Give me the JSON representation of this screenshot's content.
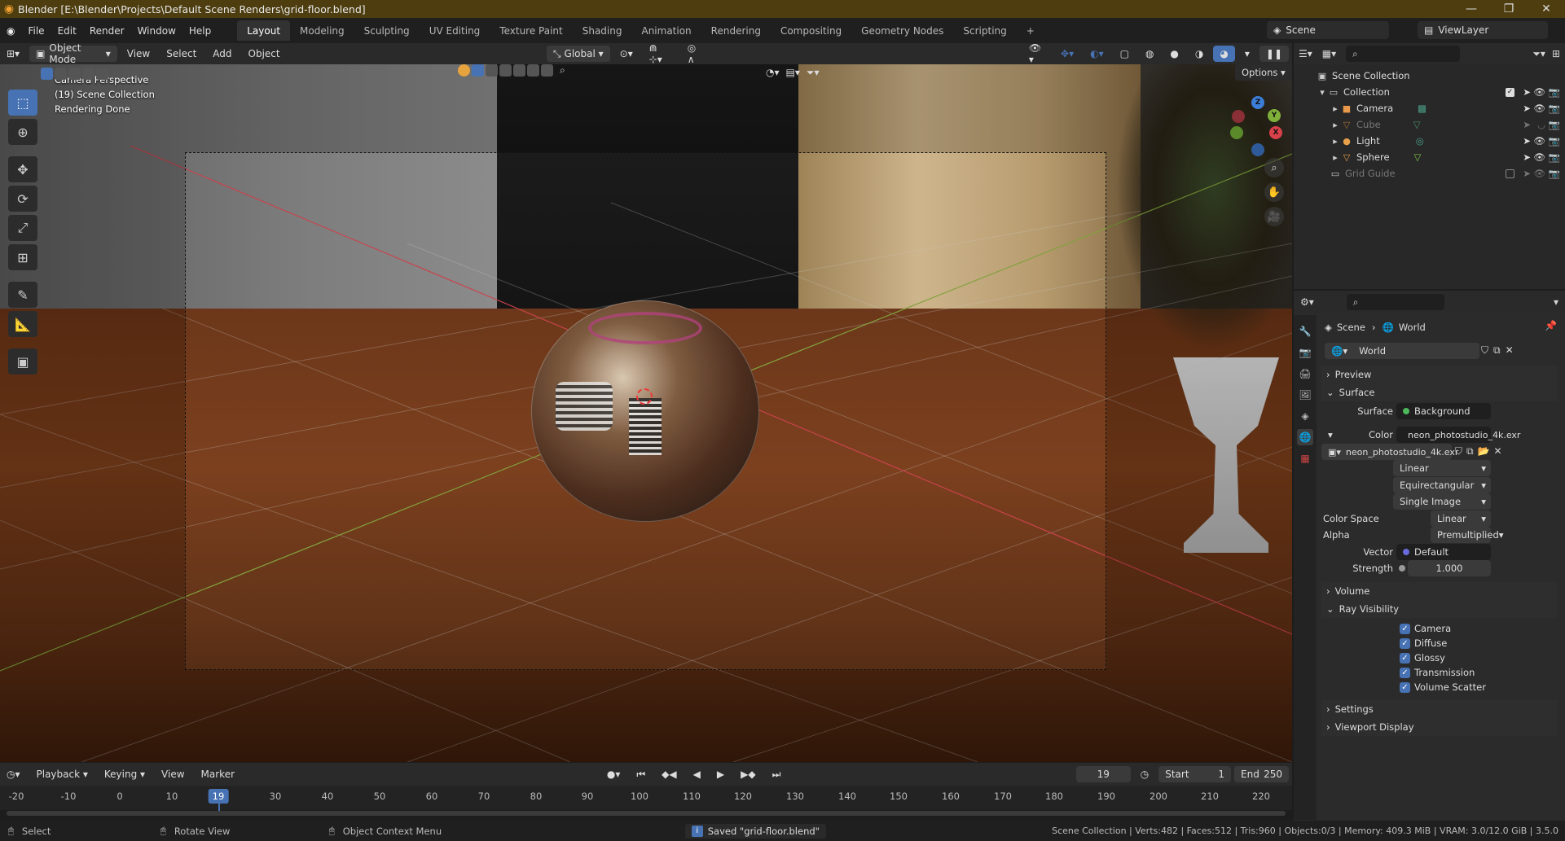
{
  "window": {
    "title": "Blender [E:\\Blender\\Projects\\Default Scene Renders\\grid-floor.blend]"
  },
  "menu": [
    "File",
    "Edit",
    "Render",
    "Window",
    "Help"
  ],
  "workspaces": [
    "Layout",
    "Modeling",
    "Sculpting",
    "UV Editing",
    "Texture Paint",
    "Shading",
    "Animation",
    "Rendering",
    "Compositing",
    "Geometry Nodes",
    "Scripting"
  ],
  "active_workspace": "Layout",
  "scene": {
    "name": "Scene",
    "viewlayer": "ViewLayer"
  },
  "viewport_header": {
    "mode": "Object Mode",
    "menus": [
      "View",
      "Select",
      "Add",
      "Object"
    ],
    "orientation": "Global"
  },
  "viewport": {
    "info": [
      "Camera Perspective",
      "(19) Scene Collection",
      "Rendering Done"
    ],
    "options_label": "Options"
  },
  "gizmo": {
    "z": "Z",
    "y": "Y",
    "x": "X"
  },
  "timeline": {
    "menus": [
      "Playback",
      "Keying",
      "View",
      "Marker"
    ],
    "current_frame": "19",
    "start_label": "Start",
    "start": "1",
    "end_label": "End",
    "end": "250",
    "ticks": [
      "-20",
      "-10",
      "0",
      "10",
      "19",
      "30",
      "40",
      "50",
      "60",
      "70",
      "80",
      "90",
      "100",
      "110",
      "120",
      "130",
      "140",
      "150",
      "160",
      "170",
      "180",
      "190",
      "200",
      "210",
      "220"
    ]
  },
  "statusbar": {
    "select": "Select",
    "rotate": "Rotate View",
    "context": "Object Context Menu",
    "saved": "Saved \"grid-floor.blend\"",
    "stats": "Scene Collection | Verts:482 | Faces:512 | Tris:960 | Objects:0/3 | Memory: 409.3 MiB | VRAM: 3.0/12.0 GiB | 3.5.0"
  },
  "outliner": {
    "root": "Scene Collection",
    "collection": "Collection",
    "items": [
      {
        "name": "Camera",
        "dim": false
      },
      {
        "name": "Cube",
        "dim": true
      },
      {
        "name": "Light",
        "dim": false
      },
      {
        "name": "Sphere",
        "dim": false
      }
    ],
    "grid_guide": "Grid Guide"
  },
  "properties": {
    "breadcrumb_scene": "Scene",
    "breadcrumb_world": "World",
    "world_name": "World",
    "preview": "Preview",
    "surface_panel": "Surface",
    "surface_label": "Surface",
    "surface_value": "Background",
    "color_label": "Color",
    "color_value": "neon_photostudio_4k.exr",
    "image_name": "neon_photostudio_4k.exr",
    "interp": "Linear",
    "projection": "Equirectangular",
    "source": "Single Image",
    "colorspace_label": "Color Space",
    "colorspace_value": "Linear",
    "alpha_label": "Alpha",
    "alpha_value": "Premultiplied",
    "vector_label": "Vector",
    "vector_value": "Default",
    "strength_label": "Strength",
    "strength_value": "1.000",
    "volume": "Volume",
    "ray_visibility": "Ray Visibility",
    "rays": [
      "Camera",
      "Diffuse",
      "Glossy",
      "Transmission",
      "Volume Scatter"
    ],
    "settings": "Settings",
    "viewport_display": "Viewport Display"
  }
}
